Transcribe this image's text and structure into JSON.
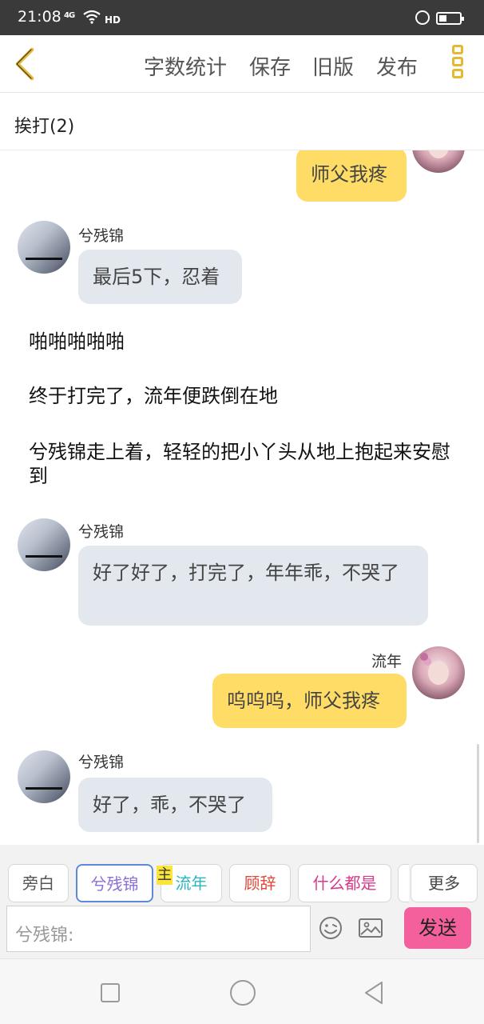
{
  "status_bar": {
    "time": "21:08",
    "network": "4G",
    "hd": "HD"
  },
  "toolbar": {
    "back_icon": "chevron-left-icon",
    "word_count": "字数统计",
    "save": "保存",
    "old_version": "旧版",
    "publish": "发布",
    "more_icon": "more-vertical-icon"
  },
  "chapter": {
    "title": "挨打(2)"
  },
  "messages": [
    {
      "type": "bubble",
      "side": "right",
      "text": "师父我疼"
    },
    {
      "type": "bubble",
      "side": "left",
      "sender": "兮残锦",
      "text": "最后5下，忍着"
    },
    {
      "type": "narration",
      "text": "啪啪啪啪啪"
    },
    {
      "type": "narration",
      "text": "终于打完了，流年便跌倒在地"
    },
    {
      "type": "narration",
      "text": "兮残锦走上着，轻轻的把小丫头从地上抱起来安慰到"
    },
    {
      "type": "bubble",
      "side": "left",
      "sender": "兮残锦",
      "text": "好了好了，打完了，年年乖，不哭了"
    },
    {
      "type": "bubble",
      "side": "right",
      "sender": "流年",
      "text": "呜呜呜，师父我疼"
    },
    {
      "type": "bubble",
      "side": "left",
      "sender": "兮残锦",
      "text": "好了，乖，不哭了"
    }
  ],
  "roles": {
    "items": [
      {
        "label": "旁白",
        "color": "#555555"
      },
      {
        "label": "兮残锦",
        "color": "#8a6fd6"
      },
      {
        "label": "流年",
        "color": "#2bb5c0"
      },
      {
        "label": "顾辞",
        "color": "#e0483a"
      },
      {
        "label": "什么都是",
        "color": "#d83a8a"
      }
    ],
    "selected": "兮残锦",
    "main_badge": "主",
    "more": "更多"
  },
  "input": {
    "placeholder": "兮残锦:",
    "send": "发送"
  },
  "colors": {
    "accent": "#fedc66",
    "send": "#f3609b",
    "left_bubble": "#e3e8ee"
  }
}
